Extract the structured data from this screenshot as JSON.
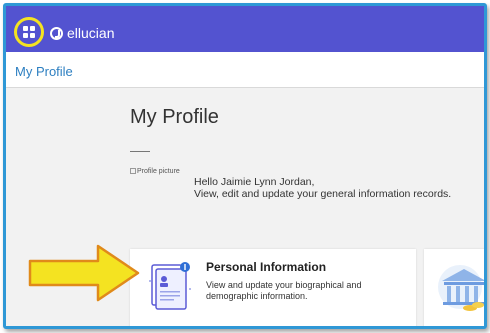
{
  "header": {
    "brand": "ellucian",
    "apps_icon": "apps-grid-icon",
    "logo_icon": "ellucian-logo-icon",
    "bar_color": "#5353d0",
    "highlight_color": "#f4e321"
  },
  "breadcrumb": {
    "label": "My Profile"
  },
  "main": {
    "title": "My Profile",
    "profile_alt": "Profile picture",
    "greeting": "Hello Jaimie Lynn Jordan,",
    "subtext": "View, edit and update your general information records."
  },
  "cards": [
    {
      "title": "Personal Information",
      "description": "View and update your biographical and demographic information.",
      "icon": "personal-info-document-icon"
    },
    {
      "title": "",
      "description": "",
      "icon": "bank-building-icon"
    }
  ],
  "annotation": {
    "icon": "yellow-arrow-icon",
    "color": "#f4e321"
  }
}
